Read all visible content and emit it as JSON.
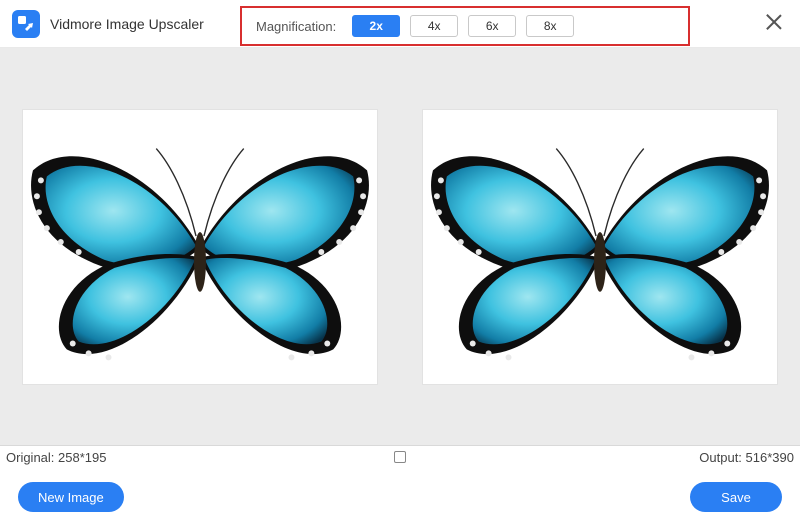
{
  "app": {
    "title": "Vidmore Image Upscaler"
  },
  "magnification": {
    "label": "Magnification:",
    "options": [
      {
        "label": "2x",
        "active": true
      },
      {
        "label": "4x",
        "active": false
      },
      {
        "label": "6x",
        "active": false
      },
      {
        "label": "8x",
        "active": false
      }
    ]
  },
  "status": {
    "original_label": "Original:",
    "original_size": "258*195",
    "output_label": "Output:",
    "output_size": "516*390"
  },
  "footer": {
    "new_image_label": "New Image",
    "save_label": "Save"
  },
  "colors": {
    "accent": "#2a7ff3",
    "highlight_border": "#d82f2f"
  }
}
